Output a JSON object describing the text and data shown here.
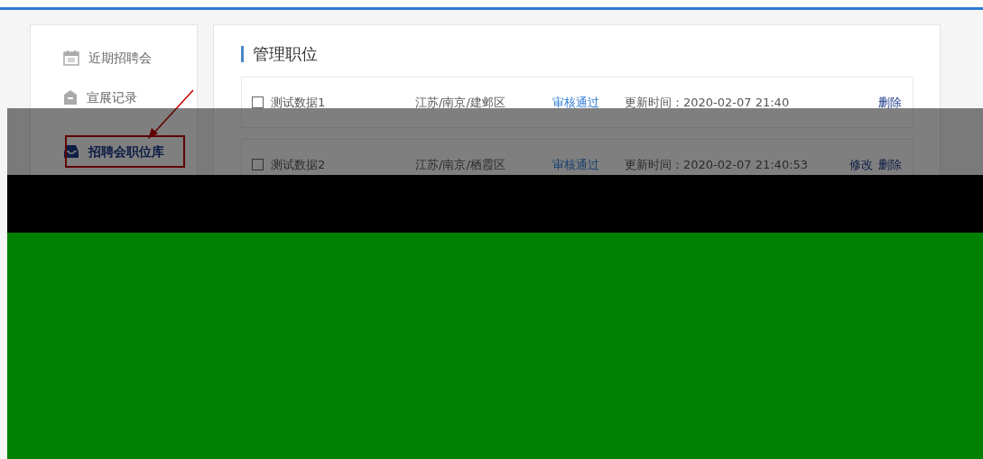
{
  "sidebar": {
    "items": [
      {
        "label": "近期招聘会",
        "selected": false
      },
      {
        "label": "宣展记录",
        "selected": false
      },
      {
        "label": "招聘会职位库",
        "selected": true
      }
    ]
  },
  "main": {
    "title": "管理职位",
    "rows": [
      {
        "name": "测试数据1",
        "checked": false,
        "location": "江苏/南京/建邺区",
        "status": "审核通过",
        "updated": "更新时间：2020-02-07 21:40",
        "actions": [
          "删除"
        ]
      },
      {
        "name": "测试数据2",
        "checked": false,
        "location": "江苏/南京/栖霞区",
        "status": "审核通过",
        "updated": "更新时间：2020-02-07 21:40:53",
        "actions": [
          "修改",
          "删除"
        ]
      }
    ]
  }
}
